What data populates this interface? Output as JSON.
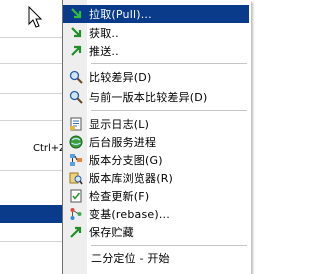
{
  "parent_menu": {
    "shortcut": "Ctrl+Z"
  },
  "submenu": {
    "items": [
      {
        "label": "拉取(Pull)...",
        "icon": "pull-icon"
      },
      {
        "label": "获取..",
        "icon": "fetch-icon"
      },
      {
        "label": "推送..",
        "icon": "push-icon"
      },
      {
        "label": "比较差异(D)",
        "icon": "diff-icon"
      },
      {
        "label": "与前一版本比较差异(D)",
        "icon": "diff-previous-icon"
      },
      {
        "label": "显示日志(L)",
        "icon": "log-icon"
      },
      {
        "label": "后台服务进程",
        "icon": "daemon-icon"
      },
      {
        "label": "版本分支图(G)",
        "icon": "revision-graph-icon"
      },
      {
        "label": "版本库浏览器(R)",
        "icon": "repo-browser-icon"
      },
      {
        "label": "检查更新(F)",
        "icon": "check-modifications-icon"
      },
      {
        "label": "变基(rebase)...",
        "icon": "rebase-icon"
      },
      {
        "label": "保存贮藏",
        "icon": "stash-save-icon"
      },
      {
        "label": "二分定位 - 开始",
        "icon": ""
      }
    ]
  },
  "colors": {
    "highlight": "#0a3b8a",
    "gutter": "#eeeeee"
  }
}
